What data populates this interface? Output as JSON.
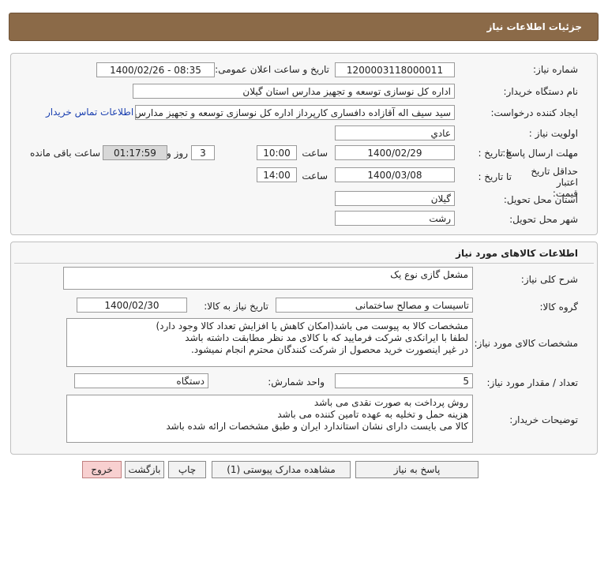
{
  "header": {
    "title": "جزئیات اطلاعات نیاز"
  },
  "info": {
    "need_no_label": "شماره نیاز:",
    "need_no": "1200003118000011",
    "announce_label": "تاریخ و ساعت اعلان عمومی:",
    "announce": "1400/02/26 - 08:35",
    "buyer_label": "نام دستگاه خریدار:",
    "buyer": "اداره کل نوسازی  توسعه و تجهیز مدارس استان گیلان",
    "creator_label": "ایجاد کننده درخواست:",
    "creator": "سید سیف اله آقازاده دافساری کارپرداز اداره کل نوسازی  توسعه و تجهیز مدارس",
    "contact_link": "اطلاعات تماس خریدار",
    "priority_label": "اولویت نیاز :",
    "priority": "عادي",
    "deadline_label": "مهلت ارسال پاسخ:",
    "to_date_label": "تا تاریخ :",
    "deadline_date": "1400/02/29",
    "time_label": "ساعت",
    "deadline_time": "10:00",
    "days": "3",
    "days_label": "روز و",
    "remaining": "01:17:59",
    "remaining_label": "ساعت باقی مانده",
    "validity_label": "حداقل تاریخ اعتبار قیمت:",
    "validity_to_label": "تا تاریخ :",
    "validity_date": "1400/03/08",
    "validity_time_label": "ساعت",
    "validity_time": "14:00",
    "province_label": "استان محل تحویل:",
    "province": "گیلان",
    "city_label": "شهر محل تحویل:",
    "city": "رشت"
  },
  "goods": {
    "title": "اطلاعات کالاهای مورد نیاز",
    "desc_label": "شرح کلی نیاز:",
    "desc": "مشعل گازی نوع یک",
    "group_label": "گروه کالا:",
    "group": "تاسیسات و مصالح ساختمانی",
    "need_date_label": "تاریخ نیاز به کالا:",
    "need_date": "1400/02/30",
    "specs_label": "مشخصات کالای مورد نیاز:",
    "specs": [
      "مشخصات کالا به پیوست می باشد(امکان کاهش یا افزایش تعداد کالا وجود دارد)",
      "لطفا با ایرانکدی شرکت فرمایید که با کالای مد نظر مطابقت داشته باشد",
      "در غیر اینصورت خرید محصول از شرکت کنندگان محترم انجام نمیشود."
    ],
    "qty_label": "تعداد / مقدار مورد نیاز:",
    "qty": "5",
    "unit_label": "واحد شمارش:",
    "unit": "دستگاه",
    "notes_label": "توضیحات خریدار:",
    "notes": [
      "روش پرداخت به صورت نقدی می باشد",
      "هزینه حمل و تخلیه به عهده تامین کننده می باشد",
      "کالا می بایست دارای نشان استاندارد ایران و طبق مشخصات ارائه شده باشد"
    ]
  },
  "buttons": {
    "respond": "پاسخ به نیاز",
    "attachments": "مشاهده مدارک پیوستی (1)",
    "print": "چاپ",
    "back": "بازگشت",
    "exit": "خروج"
  }
}
